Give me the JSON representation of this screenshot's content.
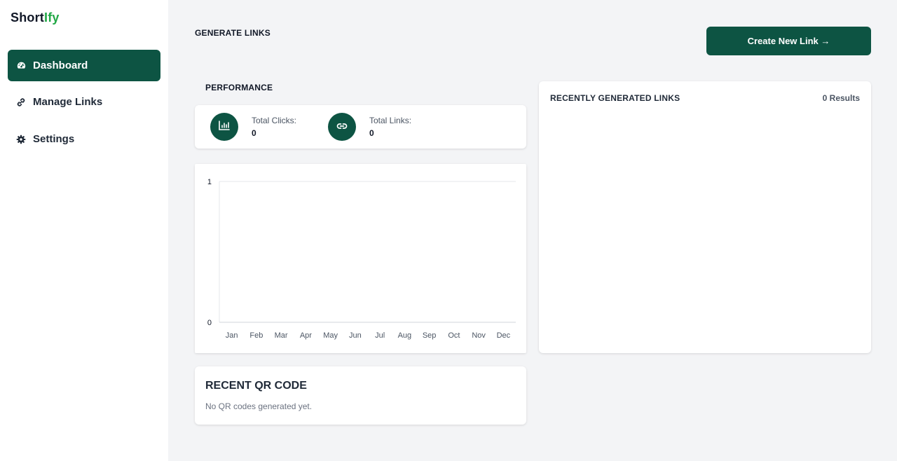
{
  "brand": {
    "name_part1": "Short",
    "name_part2": "Ify",
    "accent_color": "#22a846",
    "primary_color": "#0d5443"
  },
  "sidebar": {
    "items": [
      {
        "label": "Dashboard",
        "icon": "gauge-icon",
        "active": true
      },
      {
        "label": "Manage Links",
        "icon": "link-icon",
        "active": false
      },
      {
        "label": "Settings",
        "icon": "gear-icon",
        "active": false
      }
    ]
  },
  "header": {
    "title": "GENERATE LINKS",
    "create_button_label": "Create New Link →"
  },
  "performance": {
    "title": "PERFORMANCE",
    "stats": [
      {
        "label": "Total Clicks:",
        "value": "0",
        "icon": "bar-chart-icon"
      },
      {
        "label": "Total Links:",
        "value": "0",
        "icon": "link-icon"
      }
    ]
  },
  "chart_data": {
    "type": "line",
    "categories": [
      "Jan",
      "Feb",
      "Mar",
      "Apr",
      "May",
      "Jun",
      "Jul",
      "Aug",
      "Sep",
      "Oct",
      "Nov",
      "Dec"
    ],
    "values": [],
    "ylim": [
      0,
      1
    ],
    "yticks": [
      "0",
      "1"
    ],
    "grid": true
  },
  "qr": {
    "title": "RECENT QR CODE",
    "empty_text": "No QR codes generated yet."
  },
  "recent_links": {
    "title": "RECENTLY GENERATED LINKS",
    "count_text": "0 Results"
  }
}
